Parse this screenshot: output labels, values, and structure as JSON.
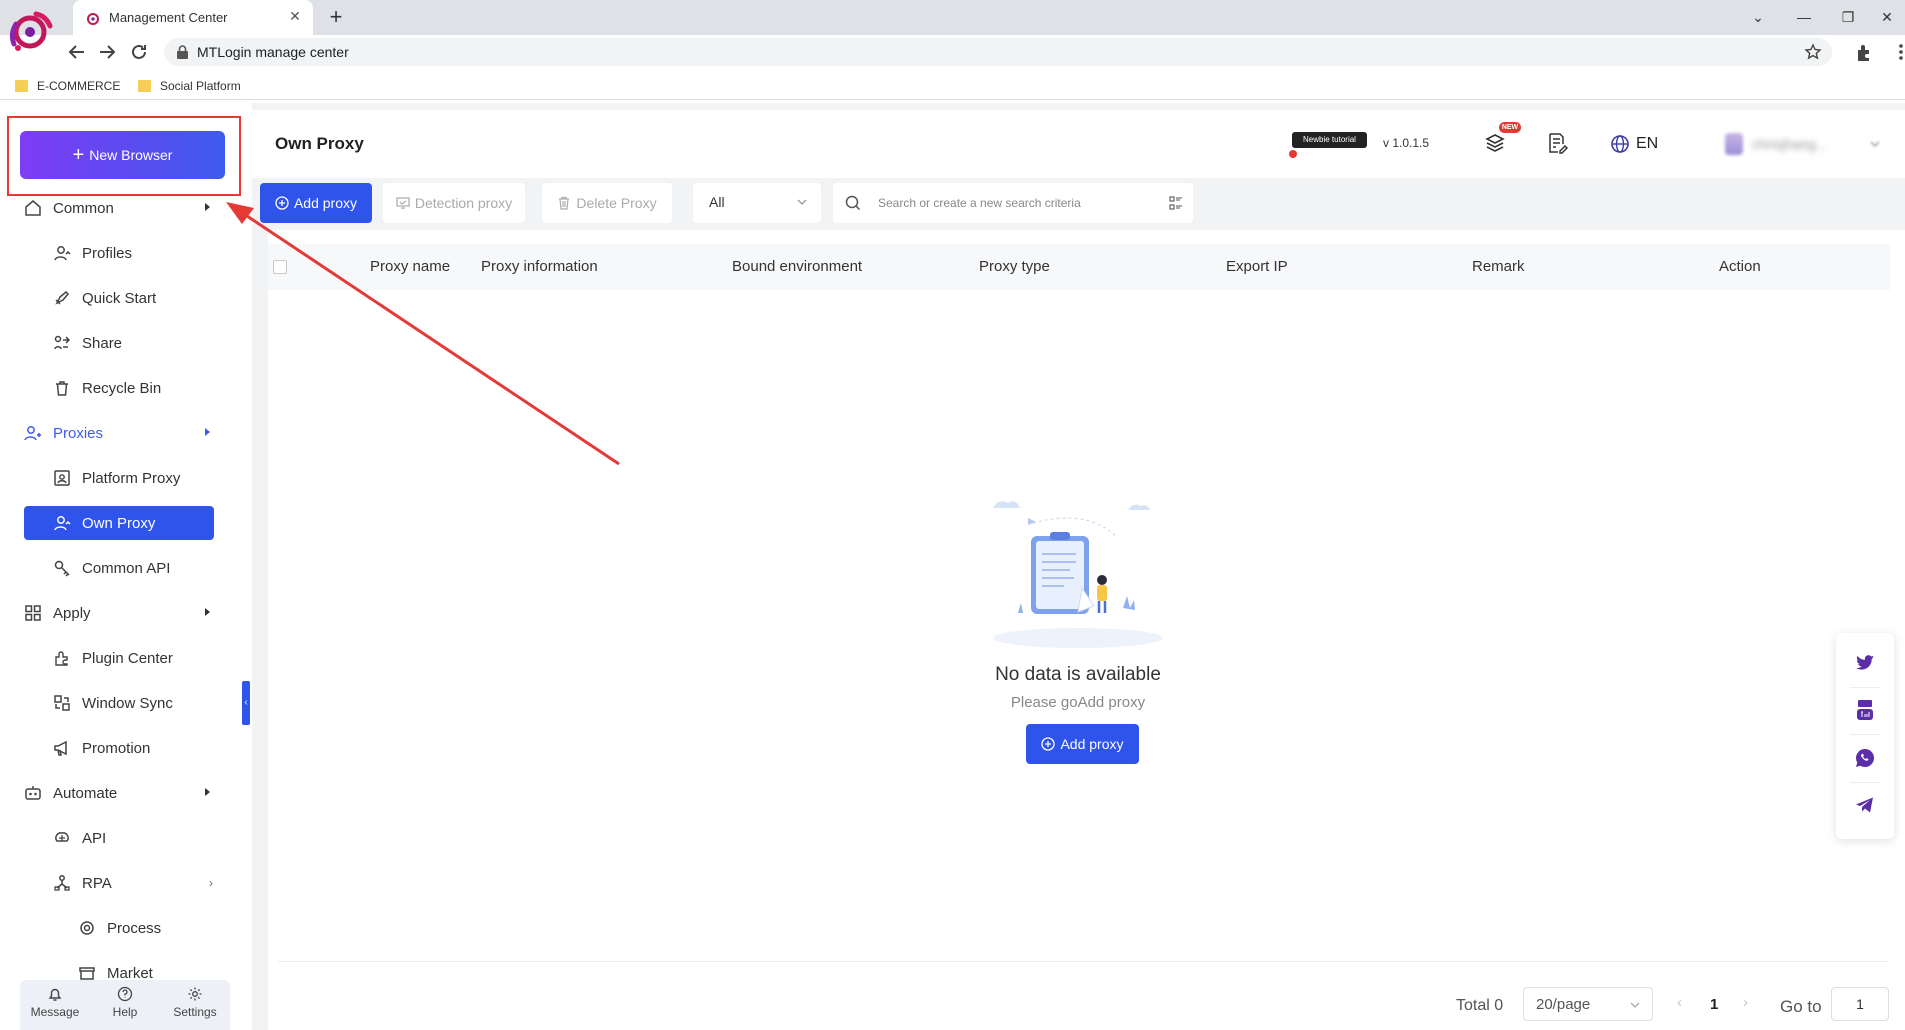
{
  "browser": {
    "tab_title": "Management Center",
    "url": "MTLogin manage center",
    "bookmarks": [
      "E-COMMERCE",
      "Social Platform"
    ]
  },
  "sidebar": {
    "new_browser": "New Browser",
    "items": [
      {
        "label": "Common",
        "level": "group"
      },
      {
        "label": "Profiles",
        "level": "sub"
      },
      {
        "label": "Quick Start",
        "level": "sub"
      },
      {
        "label": "Share",
        "level": "sub"
      },
      {
        "label": "Recycle Bin",
        "level": "sub"
      },
      {
        "label": "Proxies",
        "level": "group"
      },
      {
        "label": "Platform Proxy",
        "level": "sub"
      },
      {
        "label": "Own Proxy",
        "level": "sub",
        "active": true
      },
      {
        "label": "Common API",
        "level": "sub"
      },
      {
        "label": "Apply",
        "level": "group"
      },
      {
        "label": "Plugin Center",
        "level": "sub"
      },
      {
        "label": "Window Sync",
        "level": "sub"
      },
      {
        "label": "Promotion",
        "level": "sub"
      },
      {
        "label": "Automate",
        "level": "group"
      },
      {
        "label": "API",
        "level": "sub"
      },
      {
        "label": "RPA",
        "level": "sub"
      },
      {
        "label": "Process",
        "level": "sub2"
      },
      {
        "label": "Market",
        "level": "sub2"
      }
    ],
    "footer": {
      "message": "Message",
      "help": "Help",
      "settings": "Settings"
    }
  },
  "header": {
    "title": "Own Proxy",
    "newbie": "Newbie tutorial",
    "version": "v 1.0.1.5",
    "badge": "NEW",
    "language": "EN",
    "user": "chrisjhang..."
  },
  "actions": {
    "add_proxy": "Add proxy",
    "detection_proxy": "Detection proxy",
    "delete_proxy": "Delete Proxy",
    "filter_value": "All",
    "search_placeholder": "Search or create a new search criteria"
  },
  "table": {
    "columns": [
      "Proxy name",
      "Proxy information",
      "Bound environment",
      "Proxy type",
      "Export IP",
      "Remark",
      "Action"
    ],
    "rows": []
  },
  "empty": {
    "title": "No data is available",
    "subtitle": "Please goAdd proxy",
    "button": "Add proxy"
  },
  "pagination": {
    "total": "Total 0",
    "page_size": "20/page",
    "current_page": "1",
    "goto_label": "Go to",
    "goto_value": "1"
  },
  "social": [
    "twitter-icon",
    "youtube-icon",
    "whatsapp-icon",
    "telegram-icon"
  ],
  "colors": {
    "primary": "#2f54eb",
    "annotation": "#e53935",
    "brand_purple": "#5b2da8"
  }
}
